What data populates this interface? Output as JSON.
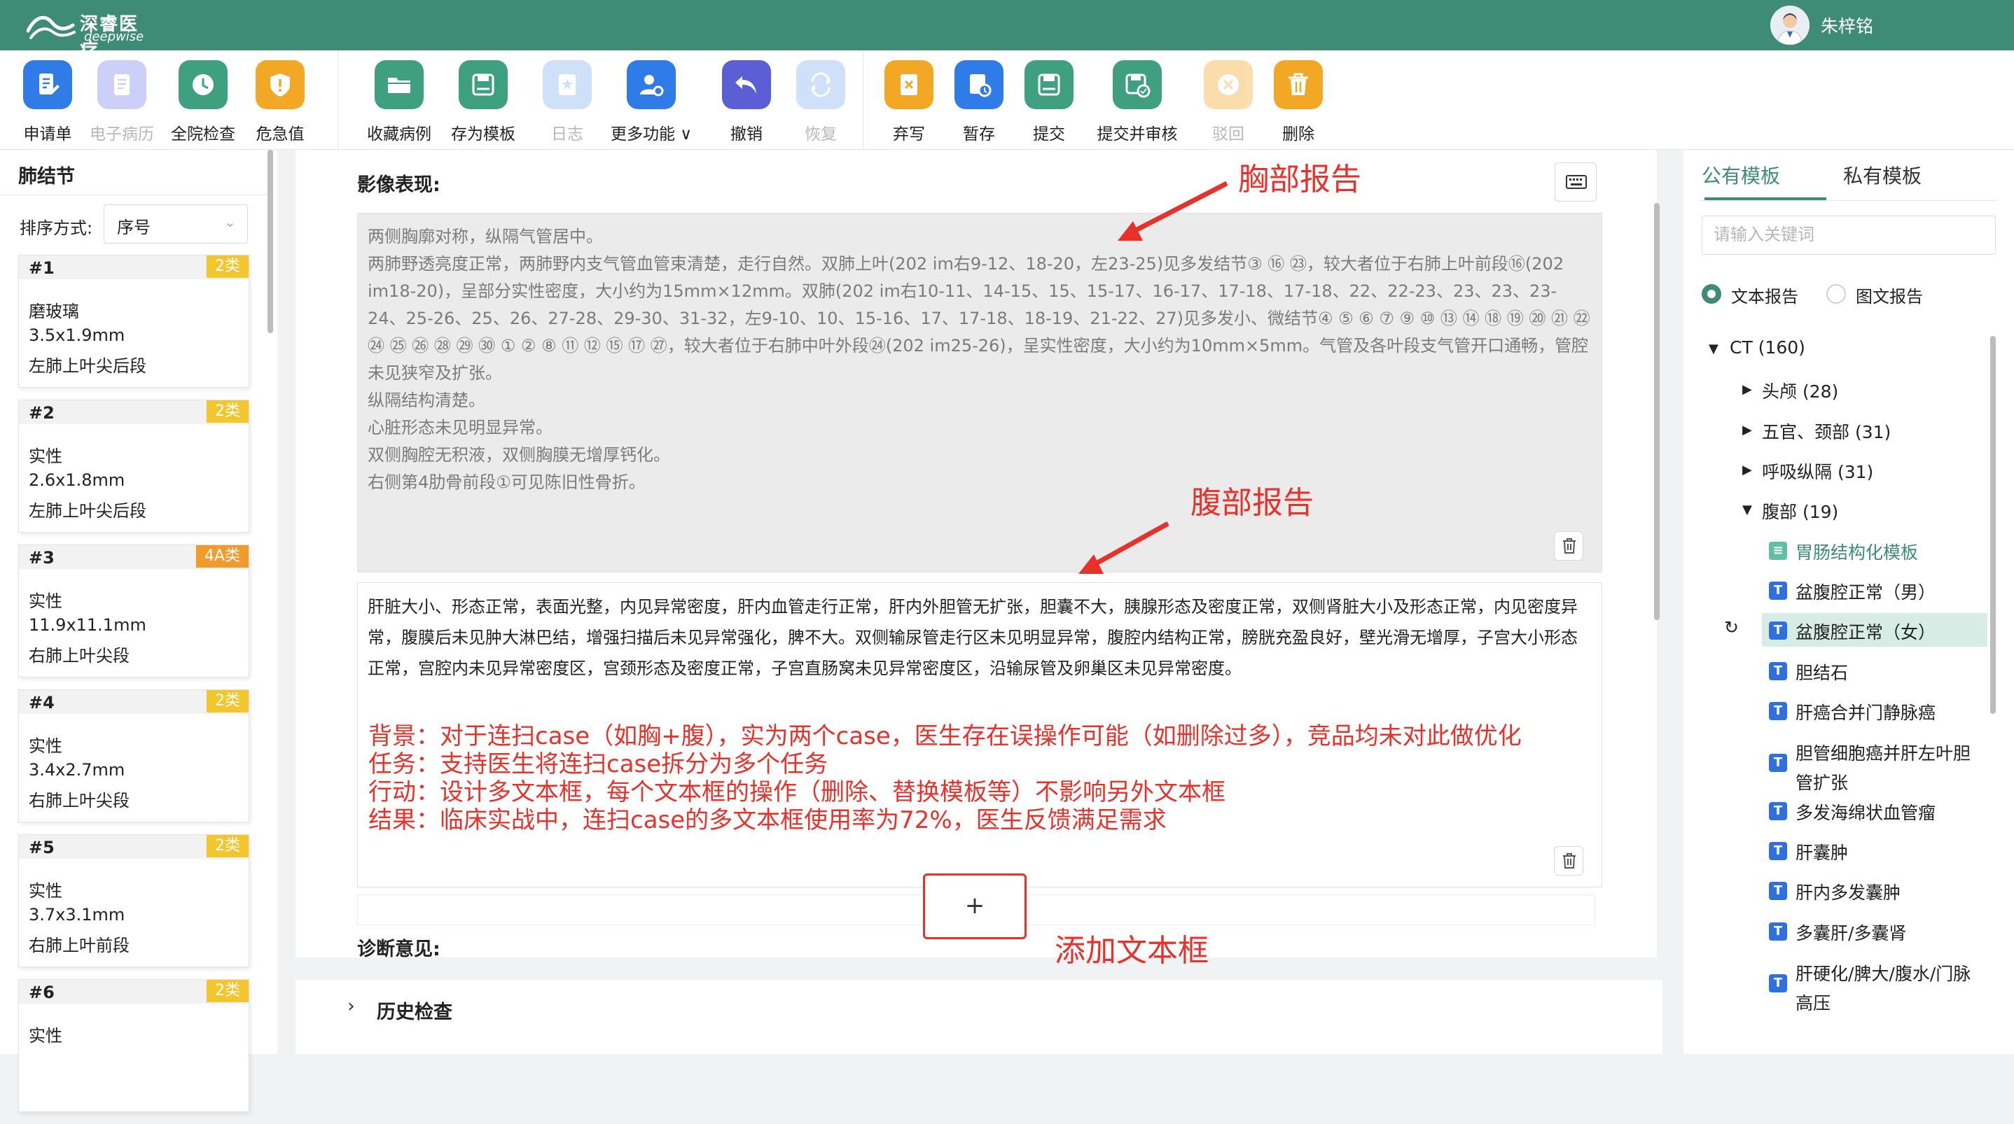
{
  "app": {
    "brand_cn": "深睿医疗",
    "brand_en": "deepwise",
    "user_name": "朱梓铭",
    "accent": "#3e8c76"
  },
  "toolbar": {
    "groups": [
      [
        {
          "label": "申请单",
          "icon": "form-icon",
          "color": "#2f7be8",
          "enabled": true
        },
        {
          "label": "电子病历",
          "icon": "document-icon",
          "color": "#7a86f0",
          "enabled": false
        },
        {
          "label": "全院检查",
          "icon": "clock-icon",
          "color": "#3fa080",
          "enabled": true
        },
        {
          "label": "危急值",
          "icon": "shield-alert-icon",
          "color": "#f3a825",
          "enabled": true
        }
      ],
      [
        {
          "label": "收藏病例",
          "icon": "folder-icon",
          "color": "#3fa080",
          "enabled": true
        },
        {
          "label": "存为模板",
          "icon": "save-template-icon",
          "color": "#3fa080",
          "enabled": true
        },
        {
          "label": "日志",
          "icon": "log-icon",
          "color": "#7fb2ee",
          "enabled": false
        },
        {
          "label": "更多功能",
          "icon": "user-settings-icon",
          "color": "#2f7be8",
          "enabled": true,
          "dropdown": true
        },
        {
          "label": "撤销",
          "icon": "undo-icon",
          "color": "#5a5fd6",
          "enabled": true
        },
        {
          "label": "恢复",
          "icon": "redo-icon",
          "color": "#7fb2ee",
          "enabled": false
        }
      ],
      [
        {
          "label": "弃写",
          "icon": "discard-icon",
          "color": "#f3a825",
          "enabled": true
        },
        {
          "label": "暂存",
          "icon": "temp-save-icon",
          "color": "#2f7be8",
          "enabled": true
        },
        {
          "label": "提交",
          "icon": "submit-icon",
          "color": "#3fa080",
          "enabled": true
        },
        {
          "label": "提交并审核",
          "icon": "submit-review-icon",
          "color": "#3fa080",
          "enabled": true
        },
        {
          "label": "驳回",
          "icon": "reject-icon",
          "color": "#f3a825",
          "enabled": false
        },
        {
          "label": "删除",
          "icon": "trash-icon",
          "color": "#f3a825",
          "enabled": true
        }
      ]
    ]
  },
  "left": {
    "title": "肺结节",
    "sort_label": "排序方式:",
    "sort_value": "序号",
    "nodules": [
      {
        "id": "#1",
        "cls": "2类",
        "cls_color": "#f3c62d",
        "type": "磨玻璃",
        "size": "3.5x1.9mm",
        "loc": "左肺上叶尖后段"
      },
      {
        "id": "#2",
        "cls": "2类",
        "cls_color": "#f3c62d",
        "type": "实性",
        "size": "2.6x1.8mm",
        "loc": "左肺上叶尖后段"
      },
      {
        "id": "#3",
        "cls": "4A类",
        "cls_color": "#f39a2d",
        "type": "实性",
        "size": "11.9x11.1mm",
        "loc": "右肺上叶尖段"
      },
      {
        "id": "#4",
        "cls": "2类",
        "cls_color": "#f3c62d",
        "type": "实性",
        "size": "3.4x2.7mm",
        "loc": "右肺上叶尖段"
      },
      {
        "id": "#5",
        "cls": "2类",
        "cls_color": "#f3c62d",
        "type": "实性",
        "size": "3.7x3.1mm",
        "loc": "右肺上叶前段"
      },
      {
        "id": "#6",
        "cls": "2类",
        "cls_color": "#f3c62d",
        "type": "实性",
        "size": "",
        "loc": ""
      }
    ]
  },
  "editor": {
    "section_label": "影像表现:",
    "box1_lines": [
      "两侧胸廓对称，纵隔气管居中。",
      "两肺野透亮度正常，两肺野内支气管血管束清楚，走行自然。双肺上叶(202 im右9-12、18-20，左23-25)见多发结节③ ⑯ ㉓，较大者位于右肺上叶前段⑯(202 im18-20)，呈部分实性密度，大小约为15mm×12mm。双肺(202 im右10-11、14-15、15、15-17、16-17、17-18、17-18、22、22-23、23、23、23-24、25-26、25、26、27-28、29-30、31-32，左9-10、10、15-16、17、17-18、18-19、21-22、27)见多发小、微结节④ ⑤ ⑥ ⑦ ⑨ ⑩ ⑬ ⑭ ⑱ ⑲ ⑳ ㉑ ㉒ ㉔ ㉕ ㉖ ㉘ ㉙ ㉚ ① ② ⑧ ⑪ ⑫ ⑮ ⑰ ㉗，较大者位于右肺中叶外段㉔(202 im25-26)，呈实性密度，大小约为10mm×5mm。气管及各叶段支气管开口通畅，管腔未见狭窄及扩张。",
      "纵隔结构清楚。",
      "心脏形态未见明显异常。",
      "双侧胸腔无积液，双侧胸膜无增厚钙化。",
      "右侧第4肋骨前段①可见陈旧性骨折。"
    ],
    "box2_text": "肝脏大小、形态正常，表面光整，内见异常密度，肝内血管走行正常，肝内外胆管无扩张，胆囊不大，胰腺形态及密度正常，双侧肾脏大小及形态正常，内见密度异常，腹膜后未见肿大淋巴结，增强扫描后未见异常强化，脾不大。双侧输尿管走行区未见明显异常，腹腔内结构正常，膀胱充盈良好，壁光滑无增厚，子宫大小形态正常，宫腔内未见异常密度区，宫颈形态及密度正常，子宫直肠窝未见异常密度区，沿输尿管及卵巢区未见异常密度。",
    "annotations_text": [
      "背景：对于连扫case（如胸+腹），实为两个case，医生存在误操作可能（如删除过多），竞品均未对此做优化",
      "任务：支持医生将连扫case拆分为多个任务",
      "行动：设计多文本框，每个文本框的操作（删除、替换模板等）不影响另外文本框",
      "结果：临床实战中，连扫case的多文本框使用率为72%，医生反馈满足需求"
    ],
    "plus_label": "+",
    "diag_label": "诊断意见:",
    "history_label": "历史检查"
  },
  "callouts": {
    "chest": "胸部报告",
    "abdomen": "腹部报告",
    "add_box": "添加文本框"
  },
  "right": {
    "tab_public": "公有模板",
    "tab_private": "私有模板",
    "search_placeholder": "请输入关键词",
    "radio_text": "文本报告",
    "radio_image": "图文报告",
    "tree": {
      "root": "CT (160)",
      "cats": [
        "头颅 (28)",
        "五官、颈部 (31)",
        "呼吸纵隔 (31)",
        "腹部 (19)"
      ],
      "items": [
        {
          "label": "胃肠结构化模板",
          "badge": "structured-template-icon",
          "line2": ""
        },
        {
          "label": "盆腹腔正常（男）",
          "badge": "text-template-icon",
          "line2": ""
        },
        {
          "label": "盆腹腔正常（女）",
          "badge": "text-template-icon",
          "line2": "",
          "selected": true
        },
        {
          "label": "胆结石",
          "badge": "text-template-icon",
          "line2": ""
        },
        {
          "label": "肝癌合并门静脉癌",
          "badge": "text-template-icon",
          "line2": ""
        },
        {
          "label": "胆管细胞癌并肝左叶胆",
          "badge": "text-template-icon",
          "line2": "管扩张"
        },
        {
          "label": "多发海绵状血管瘤",
          "badge": "text-template-icon",
          "line2": ""
        },
        {
          "label": "肝囊肿",
          "badge": "text-template-icon",
          "line2": ""
        },
        {
          "label": "肝内多发囊肿",
          "badge": "text-template-icon",
          "line2": ""
        },
        {
          "label": "多囊肝/多囊肾",
          "badge": "text-template-icon",
          "line2": ""
        },
        {
          "label": "肝硬化/脾大/腹水/门脉",
          "badge": "text-template-icon",
          "line2": "高压"
        }
      ]
    }
  }
}
